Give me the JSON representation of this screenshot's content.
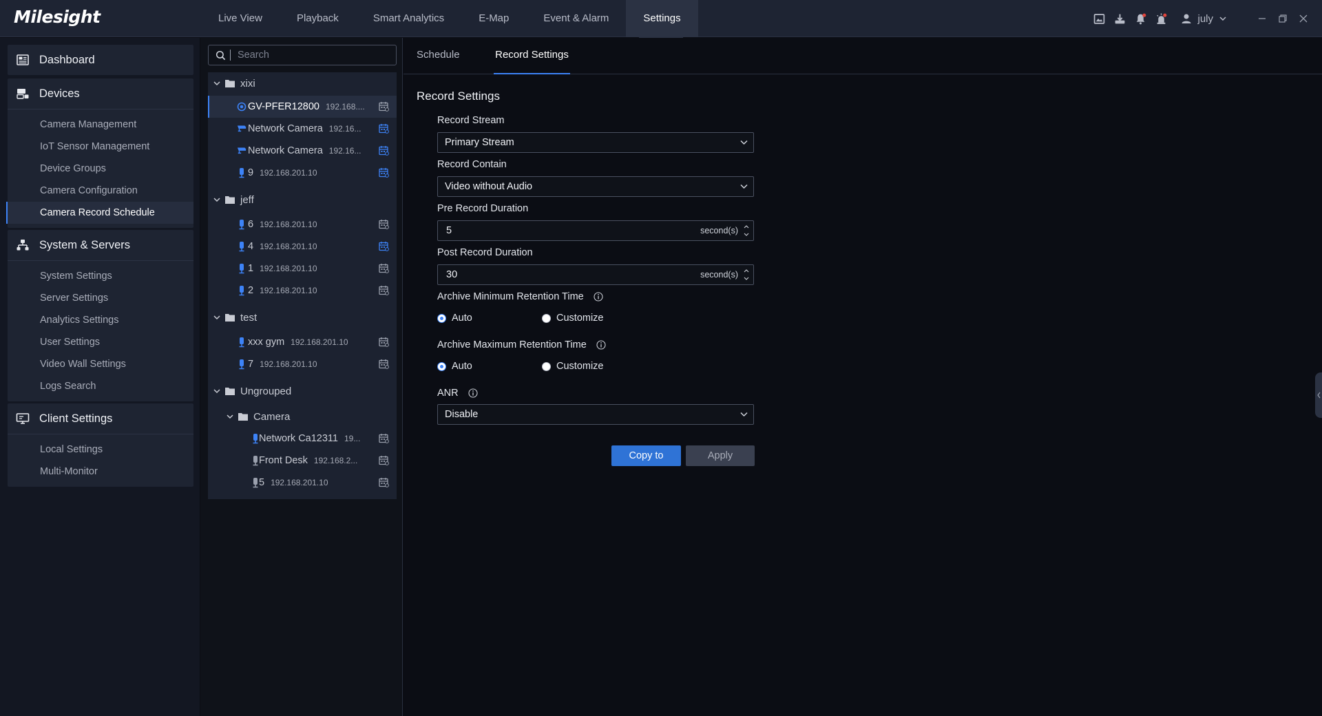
{
  "app": {
    "logo": "Milesight"
  },
  "nav": {
    "items": [
      "Live View",
      "Playback",
      "Smart Analytics",
      "E-Map",
      "Event & Alarm",
      "Settings"
    ],
    "active": "Settings"
  },
  "user": {
    "name": "july"
  },
  "sidebar": {
    "sections": [
      {
        "title": "Dashboard",
        "icon": "dashboard-icon",
        "items": []
      },
      {
        "title": "Devices",
        "icon": "devices-icon",
        "items": [
          "Camera Management",
          "IoT Sensor Management",
          "Device Groups",
          "Camera Configuration",
          "Camera Record Schedule"
        ]
      },
      {
        "title": "System & Servers",
        "icon": "server-icon",
        "items": [
          "System Settings",
          "Server Settings",
          "Analytics Settings",
          "User Settings",
          "Video Wall Settings",
          "Logs Search"
        ]
      },
      {
        "title": "Client Settings",
        "icon": "monitor-icon",
        "items": [
          "Local Settings",
          "Multi-Monitor"
        ]
      }
    ],
    "active_item": "Camera Record Schedule"
  },
  "tree": {
    "search_placeholder": "Search",
    "nodes": [
      {
        "label": "xixi",
        "type": "group",
        "level": 0
      },
      {
        "label": "GV-PFER12800",
        "ip": "192.168....",
        "type": "camera",
        "device_icon": "fisheye-camera-icon",
        "level": 1,
        "selected": true,
        "calendar_active": false
      },
      {
        "label": "Network Camera",
        "ip": "192.16...",
        "type": "camera",
        "device_icon": "bullet-camera-icon",
        "level": 1,
        "calendar_active": true
      },
      {
        "label": "Network Camera",
        "ip": "192.16...",
        "type": "camera",
        "device_icon": "bullet-camera-icon",
        "level": 1,
        "calendar_active": true
      },
      {
        "label": "9",
        "ip": "192.168.201.10",
        "type": "camera",
        "device_icon": "nvr-channel-icon",
        "level": 1,
        "calendar_active": true
      },
      {
        "label": "jeff",
        "type": "group",
        "level": 0
      },
      {
        "label": "6",
        "ip": "192.168.201.10",
        "type": "camera",
        "device_icon": "nvr-channel-icon",
        "level": 1,
        "calendar_active": false
      },
      {
        "label": "4",
        "ip": "192.168.201.10",
        "type": "camera",
        "device_icon": "nvr-channel-icon",
        "level": 1,
        "calendar_active": true
      },
      {
        "label": "1",
        "ip": "192.168.201.10",
        "type": "camera",
        "device_icon": "nvr-channel-icon",
        "level": 1,
        "calendar_active": false
      },
      {
        "label": "2",
        "ip": "192.168.201.10",
        "type": "camera",
        "device_icon": "nvr-channel-icon",
        "level": 1,
        "calendar_active": false
      },
      {
        "label": "test",
        "type": "group",
        "level": 0
      },
      {
        "label": "xxx gym",
        "ip": "192.168.201.10",
        "type": "camera",
        "device_icon": "nvr-channel-icon",
        "level": 1,
        "calendar_active": false
      },
      {
        "label": "7",
        "ip": "192.168.201.10",
        "type": "camera",
        "device_icon": "nvr-channel-icon",
        "level": 1,
        "calendar_active": false
      },
      {
        "label": "Ungrouped",
        "type": "group",
        "level": 0
      },
      {
        "label": "Camera",
        "type": "group",
        "level": 1
      },
      {
        "label": "Network Ca12311",
        "ip": "19...",
        "type": "camera",
        "device_icon": "nvr-channel-icon",
        "level": 2,
        "calendar_active": false
      },
      {
        "label": "Front Desk",
        "ip": "192.168.2...",
        "type": "camera",
        "device_icon": "offline-channel-icon",
        "level": 2,
        "calendar_active": false
      },
      {
        "label": "5",
        "ip": "192.168.201.10",
        "type": "camera",
        "device_icon": "offline-channel-icon",
        "level": 2,
        "calendar_active": false
      }
    ]
  },
  "main": {
    "tabs": [
      "Schedule",
      "Record Settings"
    ],
    "active_tab": "Record Settings",
    "section_title": "Record Settings",
    "record_stream": {
      "label": "Record Stream",
      "value": "Primary Stream"
    },
    "record_contain": {
      "label": "Record Contain",
      "value": "Video without Audio"
    },
    "pre_record": {
      "label": "Pre Record Duration",
      "value": "5",
      "unit": "second(s)"
    },
    "post_record": {
      "label": "Post Record Duration",
      "value": "30",
      "unit": "second(s)"
    },
    "archive_min": {
      "label": "Archive Minimum Retention Time",
      "options": [
        "Auto",
        "Customize"
      ],
      "selected": "Auto"
    },
    "archive_max": {
      "label": "Archive Maximum Retention Time",
      "options": [
        "Auto",
        "Customize"
      ],
      "selected": "Auto"
    },
    "anr": {
      "label": "ANR",
      "value": "Disable"
    },
    "buttons": {
      "copy_to": "Copy to",
      "apply": "Apply"
    }
  },
  "colors": {
    "accent": "#3d83f7",
    "primary_button": "#2f73d6",
    "topbar": "#1e2433",
    "sidebar": "#131722",
    "background": "#0b0d14",
    "notification_dot": "#e0443c"
  }
}
